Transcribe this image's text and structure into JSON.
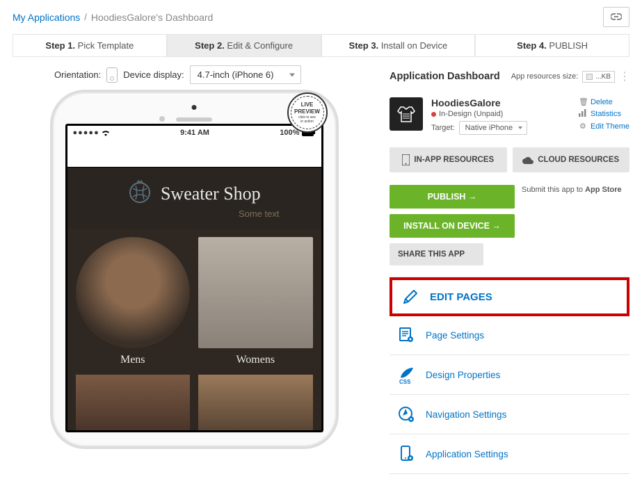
{
  "breadcrumb": {
    "root": "My Applications",
    "current": "HoodiesGalore's Dashboard"
  },
  "steps": [
    {
      "prefix": "Step 1.",
      "label": "Pick Template"
    },
    {
      "prefix": "Step 2.",
      "label": "Edit & Configure"
    },
    {
      "prefix": "Step 3.",
      "label": "Install on Device"
    },
    {
      "prefix": "Step 4.",
      "label": "PUBLISH"
    }
  ],
  "orientation_label": "Orientation:",
  "device_display_label": "Device display:",
  "device_display_value": "4.7-inch (iPhone 6)",
  "live_badge": {
    "line1": "LIVE",
    "line2": "PREVIEW",
    "line3": "click to see",
    "line4": "in action"
  },
  "statusbar": {
    "signal": "●●●●●",
    "time": "9:41 AM",
    "batt": "100%"
  },
  "hero": {
    "title": "Sweater Shop",
    "subtitle": "Some text"
  },
  "categories": [
    {
      "label": "Mens"
    },
    {
      "label": "Womens"
    }
  ],
  "dashboard": {
    "title": "Application Dashboard",
    "res_label": "App resources size:",
    "res_value": "...KB",
    "app_name": "HoodiesGalore",
    "status": "In-Design (Unpaid)",
    "target_label": "Target:",
    "target_value": "Native iPhone",
    "links": {
      "delete": "Delete",
      "stats": "Statistics",
      "theme": "Edit Theme"
    },
    "inapp": "IN-APP RESOURCES",
    "cloud": "CLOUD RESOURCES",
    "publish": "PUBLISH →",
    "install": "INSTALL ON DEVICE →",
    "share": "SHARE THIS APP",
    "submit_text_a": "Submit this app to ",
    "submit_text_b": "App Store",
    "settings": [
      {
        "label": "EDIT PAGES"
      },
      {
        "label": "Page Settings"
      },
      {
        "label": "Design Properties"
      },
      {
        "label": "Navigation Settings"
      },
      {
        "label": "Application Settings"
      }
    ]
  }
}
